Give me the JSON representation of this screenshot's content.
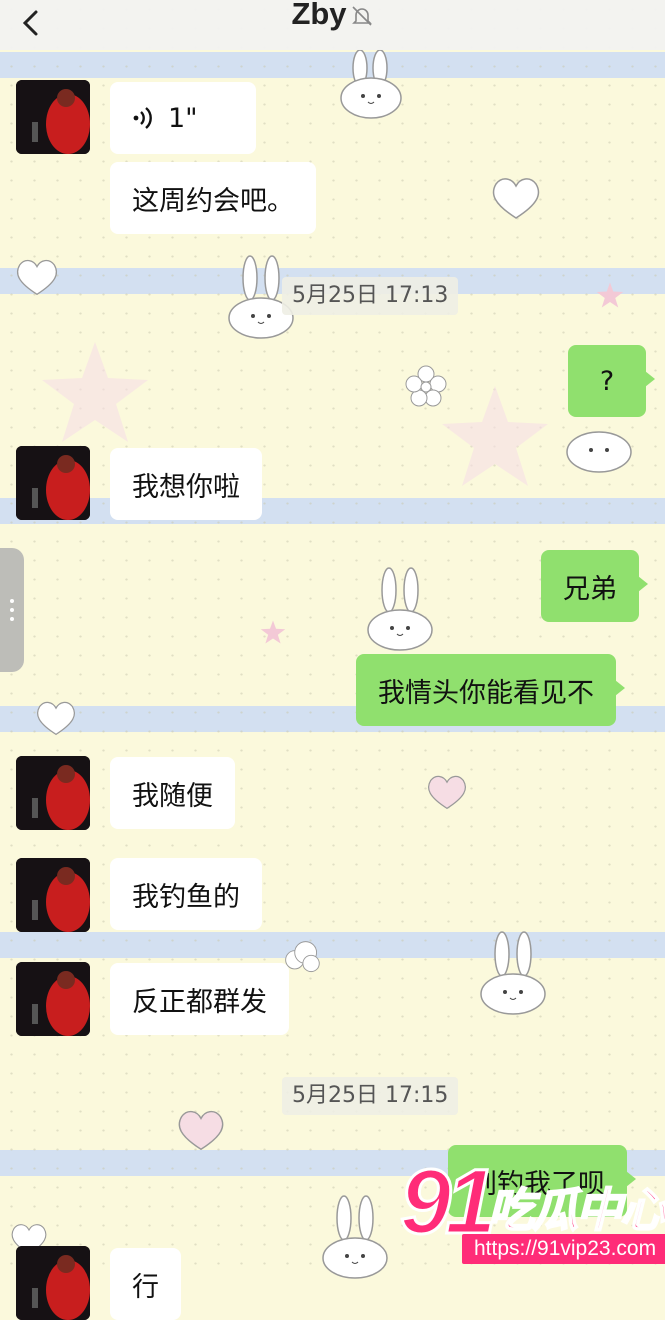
{
  "header": {
    "title": "Zby"
  },
  "timestamps": [
    "5月25日 17:13",
    "5月25日 17:15"
  ],
  "messages": {
    "m1": {
      "direction": "in",
      "type": "voice",
      "duration": "1\""
    },
    "m2": {
      "direction": "in",
      "text": "这周约会吧。"
    },
    "m3": {
      "direction": "out",
      "text": "?"
    },
    "m4": {
      "direction": "in",
      "text": "我想你啦"
    },
    "m5": {
      "direction": "out",
      "text": "兄弟"
    },
    "m6": {
      "direction": "out",
      "text": "我情头你能看见不"
    },
    "m7": {
      "direction": "in",
      "text": "我随便"
    },
    "m8": {
      "direction": "in",
      "text": "我钓鱼的"
    },
    "m9": {
      "direction": "in",
      "text": "反正都群发"
    },
    "m10": {
      "direction": "out",
      "text": "别钓我了呗"
    },
    "m11": {
      "direction": "in",
      "text": "行"
    }
  },
  "watermark": {
    "brand_number": "91",
    "brand_name": "吃瓜中心",
    "url": "https://91vip23.com"
  },
  "colors": {
    "bubble_out": "#90e06e",
    "bubble_in": "#ffffff",
    "watermark": "#ff2c78"
  },
  "icons": [
    "back-chevron-icon",
    "mute-bell-icon",
    "voice-wave-icon",
    "more-dots-icon"
  ]
}
